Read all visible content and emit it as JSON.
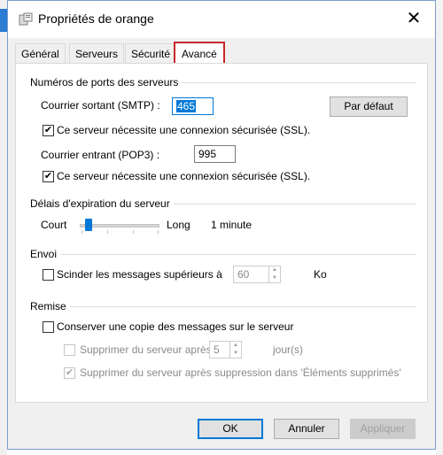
{
  "window": {
    "title": "Propriétés de orange",
    "close_icon": "close-icon"
  },
  "tabs": [
    {
      "label": "Général"
    },
    {
      "label": "Serveurs"
    },
    {
      "label": "Sécurité"
    },
    {
      "label": "Avancé",
      "active": true
    }
  ],
  "ports": {
    "heading": "Numéros de ports des serveurs",
    "smtp_label": "Courrier sortant (SMTP) :",
    "smtp_value": "465",
    "default_button": "Par défaut",
    "smtp_ssl_label": "Ce serveur nécessite une connexion sécurisée (SSL).",
    "smtp_ssl_checked": true,
    "pop3_label": "Courrier entrant (POP3) :",
    "pop3_value": "995",
    "pop3_ssl_label": "Ce serveur nécessite une connexion sécurisée (SSL).",
    "pop3_ssl_checked": true
  },
  "timeout": {
    "heading": "Délais d'expiration du serveur",
    "short_label": "Court",
    "long_label": "Long",
    "value_text": "1 minute",
    "level_fraction": 0.1
  },
  "send": {
    "heading": "Envoi",
    "split_label": "Scinder les messages supérieurs à",
    "split_checked": false,
    "split_value": "60",
    "unit": "Ko"
  },
  "delivery": {
    "heading": "Remise",
    "keep_copy_label": "Conserver une copie des messages sur le serveur",
    "keep_copy_checked": false,
    "remove_after_label": "Supprimer du serveur après",
    "remove_after_checked": false,
    "remove_after_value": "5",
    "days_label": "jour(s)",
    "remove_deleted_label": "Supprimer du serveur après suppression dans 'Éléments supprimés'",
    "remove_deleted_checked": true
  },
  "footer": {
    "ok": "OK",
    "cancel": "Annuler",
    "apply": "Appliquer"
  },
  "colors": {
    "accent": "#0078d7",
    "active_tab_border": "#c62828"
  }
}
